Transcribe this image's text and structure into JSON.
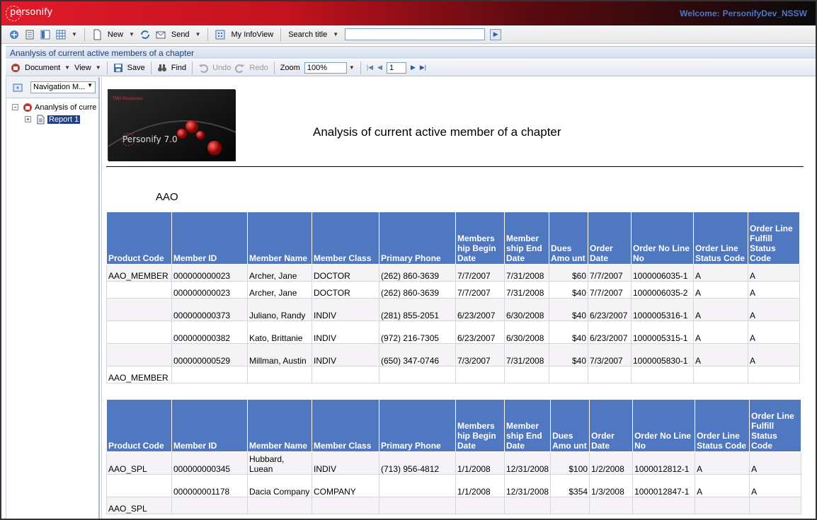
{
  "app": {
    "brand": "personify",
    "welcome_label": "Welcome:",
    "welcome_user": "PersonifyDev_NSSW",
    "accent": "#4f78c0"
  },
  "toolbar1": {
    "new_label": "New",
    "send_label": "Send",
    "infoview_label": "My InfoView",
    "search_label": "Search title",
    "search_value": ""
  },
  "title_bar": {
    "text": "Ananlysis of current active members of a chapter"
  },
  "toolbar2": {
    "document_label": "Document",
    "view_label": "View",
    "save_label": "Save",
    "find_label": "Find",
    "undo_label": "Undo",
    "redo_label": "Redo",
    "zoom_label": "Zoom",
    "zoom_value": "100%",
    "page_value": "1"
  },
  "nav": {
    "mode": "Navigation M...",
    "root_label": "Ananlysis of curre",
    "child_label": "Report 1"
  },
  "report": {
    "banner_text": "Personify 7.0",
    "banner_brand": "TMA Resources",
    "title": "Analysis of current active member of a chapter",
    "group": "AAO",
    "headers": [
      "Product Code",
      "Member ID",
      "Member Name",
      "Member Class",
      "Primary Phone",
      "Members hip Begin Date",
      "Member ship End Date",
      "Dues Amo unt",
      "Order Date",
      "Order No Line No",
      "Order Line Status Code",
      "Order Line Fulfill Status Code"
    ],
    "table1": [
      [
        "AAO_MEMBER",
        "000000000023",
        "Archer, Jane",
        "DOCTOR",
        "(262) 860-3639",
        "7/7/2007",
        "7/31/2008",
        "$60",
        "7/7/2007",
        "1000006035-1",
        "A",
        "A"
      ],
      [
        "",
        "000000000023",
        "Archer, Jane",
        "DOCTOR",
        "(262) 860-3639",
        "7/7/2007",
        "7/31/2008",
        "$40",
        "7/7/2007",
        "1000006035-2",
        "A",
        "A"
      ],
      [
        "",
        "000000000373",
        "Juliano, Randy",
        "INDIV",
        "(281) 855-2051",
        "6/23/2007",
        "6/30/2008",
        "$40",
        "6/23/2007",
        "1000005316-1",
        "A",
        "A"
      ],
      [
        "",
        "000000000382",
        "Kato, Brittanie",
        "INDIV",
        "(972) 216-7305",
        "6/23/2007",
        "6/30/2008",
        "$40",
        "6/23/2007",
        "1000005315-1",
        "A",
        "A"
      ],
      [
        "",
        "000000000529",
        "Millman, Austin",
        "INDIV",
        "(650) 347-0746",
        "7/3/2007",
        "7/31/2008",
        "$40",
        "7/3/2007",
        "1000005830-1",
        "A",
        "A"
      ],
      [
        "AAO_MEMBER",
        "",
        "",
        "",
        "",
        "",
        "",
        "",
        "",
        "",
        "",
        ""
      ]
    ],
    "table2": [
      [
        "AAO_SPL",
        "000000000345",
        "Hubbard, Luean",
        "INDIV",
        "(713) 956-4812",
        "1/1/2008",
        "12/31/2008",
        "$100",
        "1/2/2008",
        "1000012812-1",
        "A",
        "A"
      ],
      [
        "",
        "000000001178",
        "Dacia Company",
        "COMPANY",
        "",
        "1/1/2008",
        "12/31/2008",
        "$354",
        "1/3/2008",
        "1000012847-1",
        "A",
        "A"
      ],
      [
        "AAO_SPL",
        "",
        "",
        "",
        "",
        "",
        "",
        "",
        "",
        "",
        "",
        ""
      ]
    ]
  }
}
